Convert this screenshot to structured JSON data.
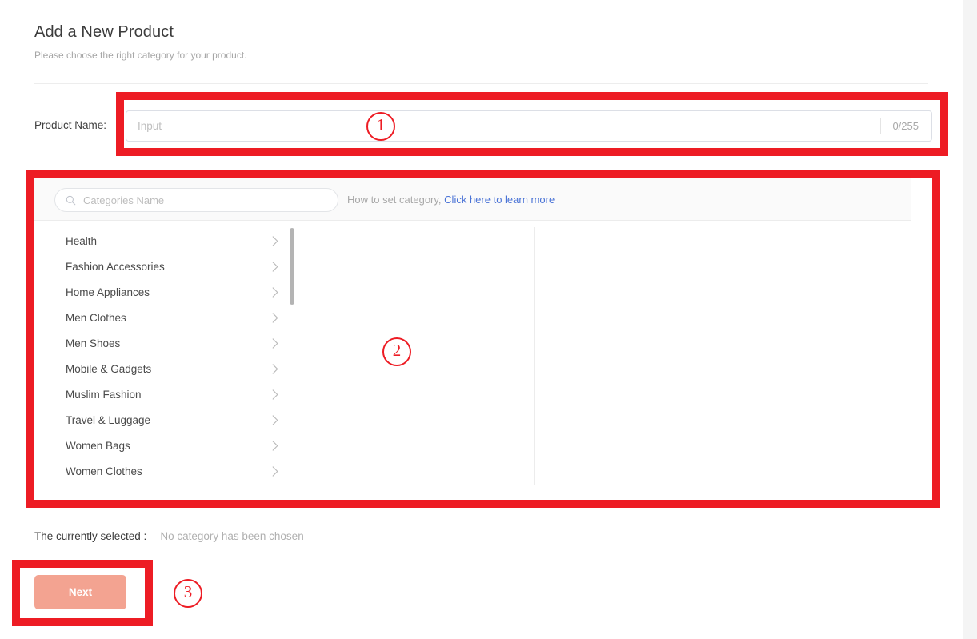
{
  "page": {
    "title": "Add a New Product",
    "subtitle": "Please choose the right category for your product."
  },
  "product_name_field": {
    "label": "Product Name:",
    "placeholder": "Input",
    "value": "",
    "counter": "0/255"
  },
  "category_panel": {
    "search": {
      "placeholder": "Categories Name",
      "value": "",
      "icon": "search-icon"
    },
    "hint_text": "How to set category,",
    "hint_link": "Click here to learn more",
    "hint_link_color": "#4a73d6",
    "categories": [
      {
        "label": "Health",
        "chevron": "chevron-right-icon"
      },
      {
        "label": "Fashion Accessories",
        "chevron": "chevron-right-icon"
      },
      {
        "label": "Home Appliances",
        "chevron": "chevron-right-icon"
      },
      {
        "label": "Men Clothes",
        "chevron": "chevron-right-icon"
      },
      {
        "label": "Men Shoes",
        "chevron": "chevron-right-icon"
      },
      {
        "label": "Mobile & Gadgets",
        "chevron": "chevron-right-icon"
      },
      {
        "label": "Muslim Fashion",
        "chevron": "chevron-right-icon"
      },
      {
        "label": "Travel & Luggage",
        "chevron": "chevron-right-icon"
      },
      {
        "label": "Women Bags",
        "chevron": "chevron-right-icon"
      },
      {
        "label": "Women Clothes",
        "chevron": "chevron-right-icon"
      }
    ],
    "column_2_items": [],
    "column_3_items": []
  },
  "selected": {
    "label": "The currently selected :",
    "value": "No category has been chosen"
  },
  "actions": {
    "next_label": "Next",
    "next_color": "#f3a391"
  },
  "annotations": {
    "color": "#ed1c24",
    "markers": [
      {
        "id": "1",
        "glyph": "①",
        "number": "1"
      },
      {
        "id": "2",
        "glyph": "②",
        "number": "2"
      },
      {
        "id": "3",
        "glyph": "③",
        "number": "3"
      }
    ]
  }
}
